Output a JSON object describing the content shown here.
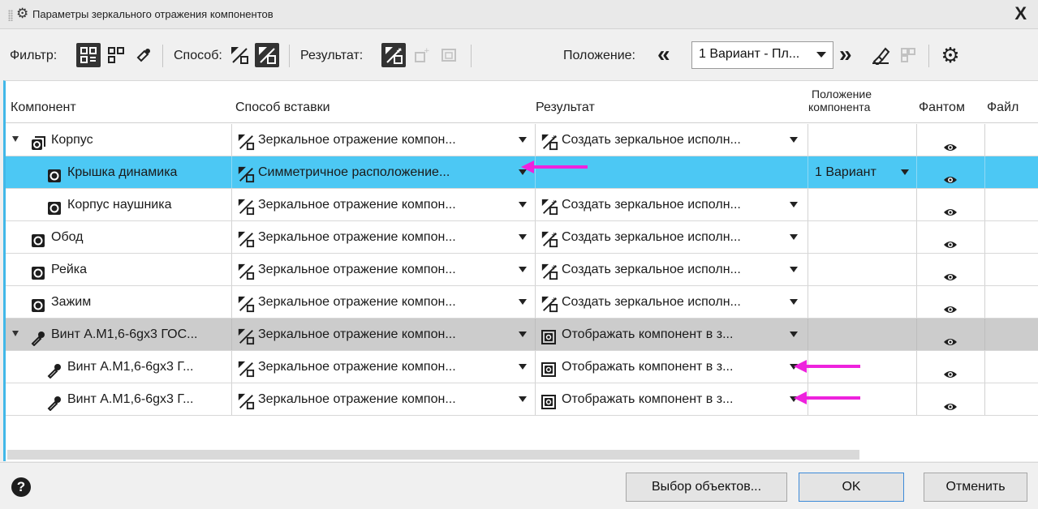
{
  "window": {
    "title": "Параметры зеркального отражения компонентов",
    "close_label": "X"
  },
  "toolbar": {
    "filter_label": "Фильтр:",
    "method_label": "Способ:",
    "result_label": "Результат:",
    "position_label": "Положение:",
    "position_value": "1 Вариант - Пл...",
    "prev_label": "«",
    "next_label": "»"
  },
  "table": {
    "headers": {
      "component": "Компонент",
      "method": "Способ вставки",
      "result": "Результат",
      "position_line1": "Положение",
      "position_line2": "компонента",
      "phantom": "Фантом",
      "file": "Файл"
    },
    "rows": [
      {
        "name": "Корпус",
        "method": "Зеркальное отражение компон...",
        "result": "Создать зеркальное исполн...",
        "position": "",
        "phantom": "eye",
        "style": "normal",
        "expanded": true
      },
      {
        "name": "Крышка динамика",
        "method": "Симметричное расположение...",
        "result": "",
        "position": "1 Вариант",
        "phantom": "eye",
        "style": "selected"
      },
      {
        "name": "Корпус наушника",
        "method": "Зеркальное отражение компон...",
        "result": "Создать зеркальное исполн...",
        "position": "",
        "phantom": "eye",
        "style": "normal"
      },
      {
        "name": "Обод",
        "method": "Зеркальное отражение компон...",
        "result": "Создать зеркальное исполн...",
        "position": "",
        "phantom": "eye",
        "style": "normal"
      },
      {
        "name": "Рейка",
        "method": "Зеркальное отражение компон...",
        "result": "Создать зеркальное исполн...",
        "position": "",
        "phantom": "eye",
        "style": "normal"
      },
      {
        "name": "Зажим",
        "method": "Зеркальное отражение компон...",
        "result": "Создать зеркальное исполн...",
        "position": "",
        "phantom": "eye",
        "style": "normal"
      },
      {
        "name": "Винт А.М1,6-6gx3 ГОС...",
        "method": "Зеркальное отражение компон...",
        "result": "Отображать компонент в з...",
        "position": "",
        "phantom": "eye",
        "style": "group",
        "expanded": true
      },
      {
        "name": "Винт А.М1,6-6gx3 Г...",
        "method": "Зеркальное отражение компон...",
        "result": "Отображать компонент в з...",
        "position": "",
        "phantom": "eye",
        "style": "normal"
      },
      {
        "name": "Винт А.М1,6-6gx3 Г...",
        "method": "Зеркальное отражение компон...",
        "result": "Отображать компонент в з...",
        "position": "",
        "phantom": "eye",
        "style": "normal"
      }
    ]
  },
  "footer": {
    "help_label": "?",
    "select_objects": "Выбор объектов...",
    "ok": "OK",
    "cancel": "Отменить"
  },
  "colors": {
    "selection": "#4cc8f4",
    "group_row": "#cccccc",
    "annotation_arrow": "#ee22dd",
    "focus_border": "#42b8e8"
  }
}
